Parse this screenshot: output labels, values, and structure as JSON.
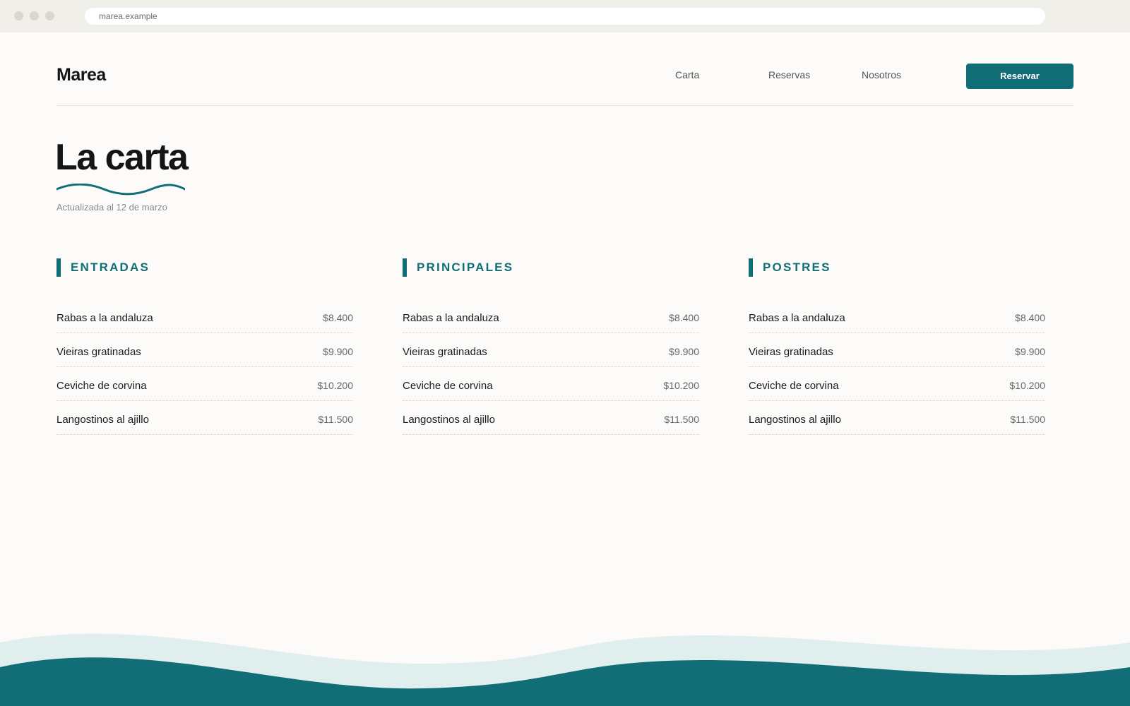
{
  "browser": {
    "url": "marea.example"
  },
  "header": {
    "brand": "Marea",
    "nav": [
      "Carta",
      "Reservas",
      "Nosotros"
    ],
    "cta_label": "Reservar"
  },
  "page": {
    "title": "La carta",
    "subtitle": "Actualizada al 12 de marzo"
  },
  "sections": [
    {
      "title": "ENTRADAS",
      "items": [
        {
          "name": "Rabas a la andaluza",
          "price": "$8.400"
        },
        {
          "name": "Vieiras gratinadas",
          "price": "$9.900"
        },
        {
          "name": "Ceviche de corvina",
          "price": "$10.200"
        },
        {
          "name": "Langostinos al ajillo",
          "price": "$11.500"
        }
      ]
    },
    {
      "title": "PRINCIPALES",
      "items": [
        {
          "name": "Rabas a la andaluza",
          "price": "$8.400"
        },
        {
          "name": "Vieiras gratinadas",
          "price": "$9.900"
        },
        {
          "name": "Ceviche de corvina",
          "price": "$10.200"
        },
        {
          "name": "Langostinos al ajillo",
          "price": "$11.500"
        }
      ]
    },
    {
      "title": "POSTRES",
      "items": [
        {
          "name": "Rabas a la andaluza",
          "price": "$8.400"
        },
        {
          "name": "Vieiras gratinadas",
          "price": "$9.900"
        },
        {
          "name": "Ceviche de corvina",
          "price": "$10.200"
        },
        {
          "name": "Langostinos al ajillo",
          "price": "$11.500"
        }
      ]
    }
  ],
  "colors": {
    "accent": "#126e76",
    "wave_light": "#e1eeee",
    "background": "#fcfbf9"
  }
}
